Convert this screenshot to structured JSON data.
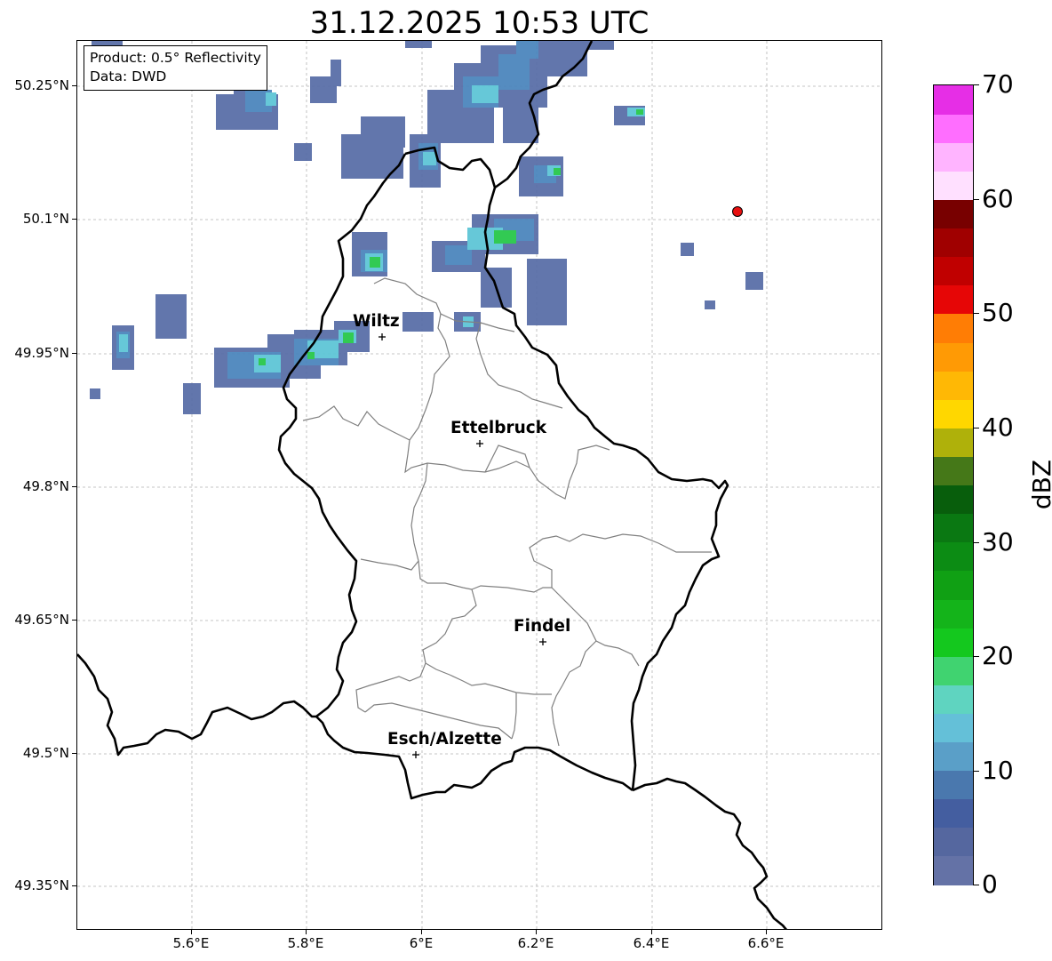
{
  "title": "31.12.2025 10:53 UTC",
  "info": {
    "product": "Product: 0.5° Reflectivity",
    "source": "Data: DWD"
  },
  "latitude_ticks": [
    "50.25°N",
    "50.1°N",
    "49.95°N",
    "49.8°N",
    "49.65°N",
    "49.5°N",
    "49.35°N"
  ],
  "longitude_ticks": [
    "5.6°E",
    "5.8°E",
    "6°E",
    "6.2°E",
    "6.4°E",
    "6.6°E"
  ],
  "cities": [
    {
      "name": "Wiltz",
      "lon": 5.93,
      "lat": 49.966
    },
    {
      "name": "Ettelbruck",
      "lon": 6.1,
      "lat": 49.85
    },
    {
      "name": "Findel",
      "lon": 6.21,
      "lat": 49.627
    },
    {
      "name": "Esch/Alzette",
      "lon": 5.99,
      "lat": 49.5
    }
  ],
  "radar_site_marker": {
    "lon": 6.548,
    "lat": 50.11,
    "color": "#e81010"
  },
  "colorbar": {
    "unit": "dBZ",
    "min": 0,
    "max": 70,
    "tick_labels": [
      "70",
      "60",
      "50",
      "40",
      "30",
      "20",
      "10",
      "0"
    ],
    "colors": [
      "#6472a6",
      "#55679f",
      "#445ea0",
      "#4a78ae",
      "#5a9fc8",
      "#64c0d8",
      "#5fd4c0",
      "#40d370",
      "#14c81e",
      "#14b41a",
      "#10a014",
      "#0c8c14",
      "#0a7812",
      "#085e0c",
      "#457818",
      "#afb10a",
      "#ffd700",
      "#ffb805",
      "#ff9a05",
      "#ff7d05",
      "#e60606",
      "#c00000",
      "#a00000",
      "#780000",
      "#ffe0ff",
      "#ffb4ff",
      "#ff6eff",
      "#e62ee6"
    ]
  },
  "colors": {
    "echo_light": "#5a6fa8",
    "echo_mid": "#4c86bd",
    "echo_cyan": "#5ec6d6",
    "echo_green": "#28c84a",
    "border": "#000000",
    "canton_lines": "#808080"
  }
}
